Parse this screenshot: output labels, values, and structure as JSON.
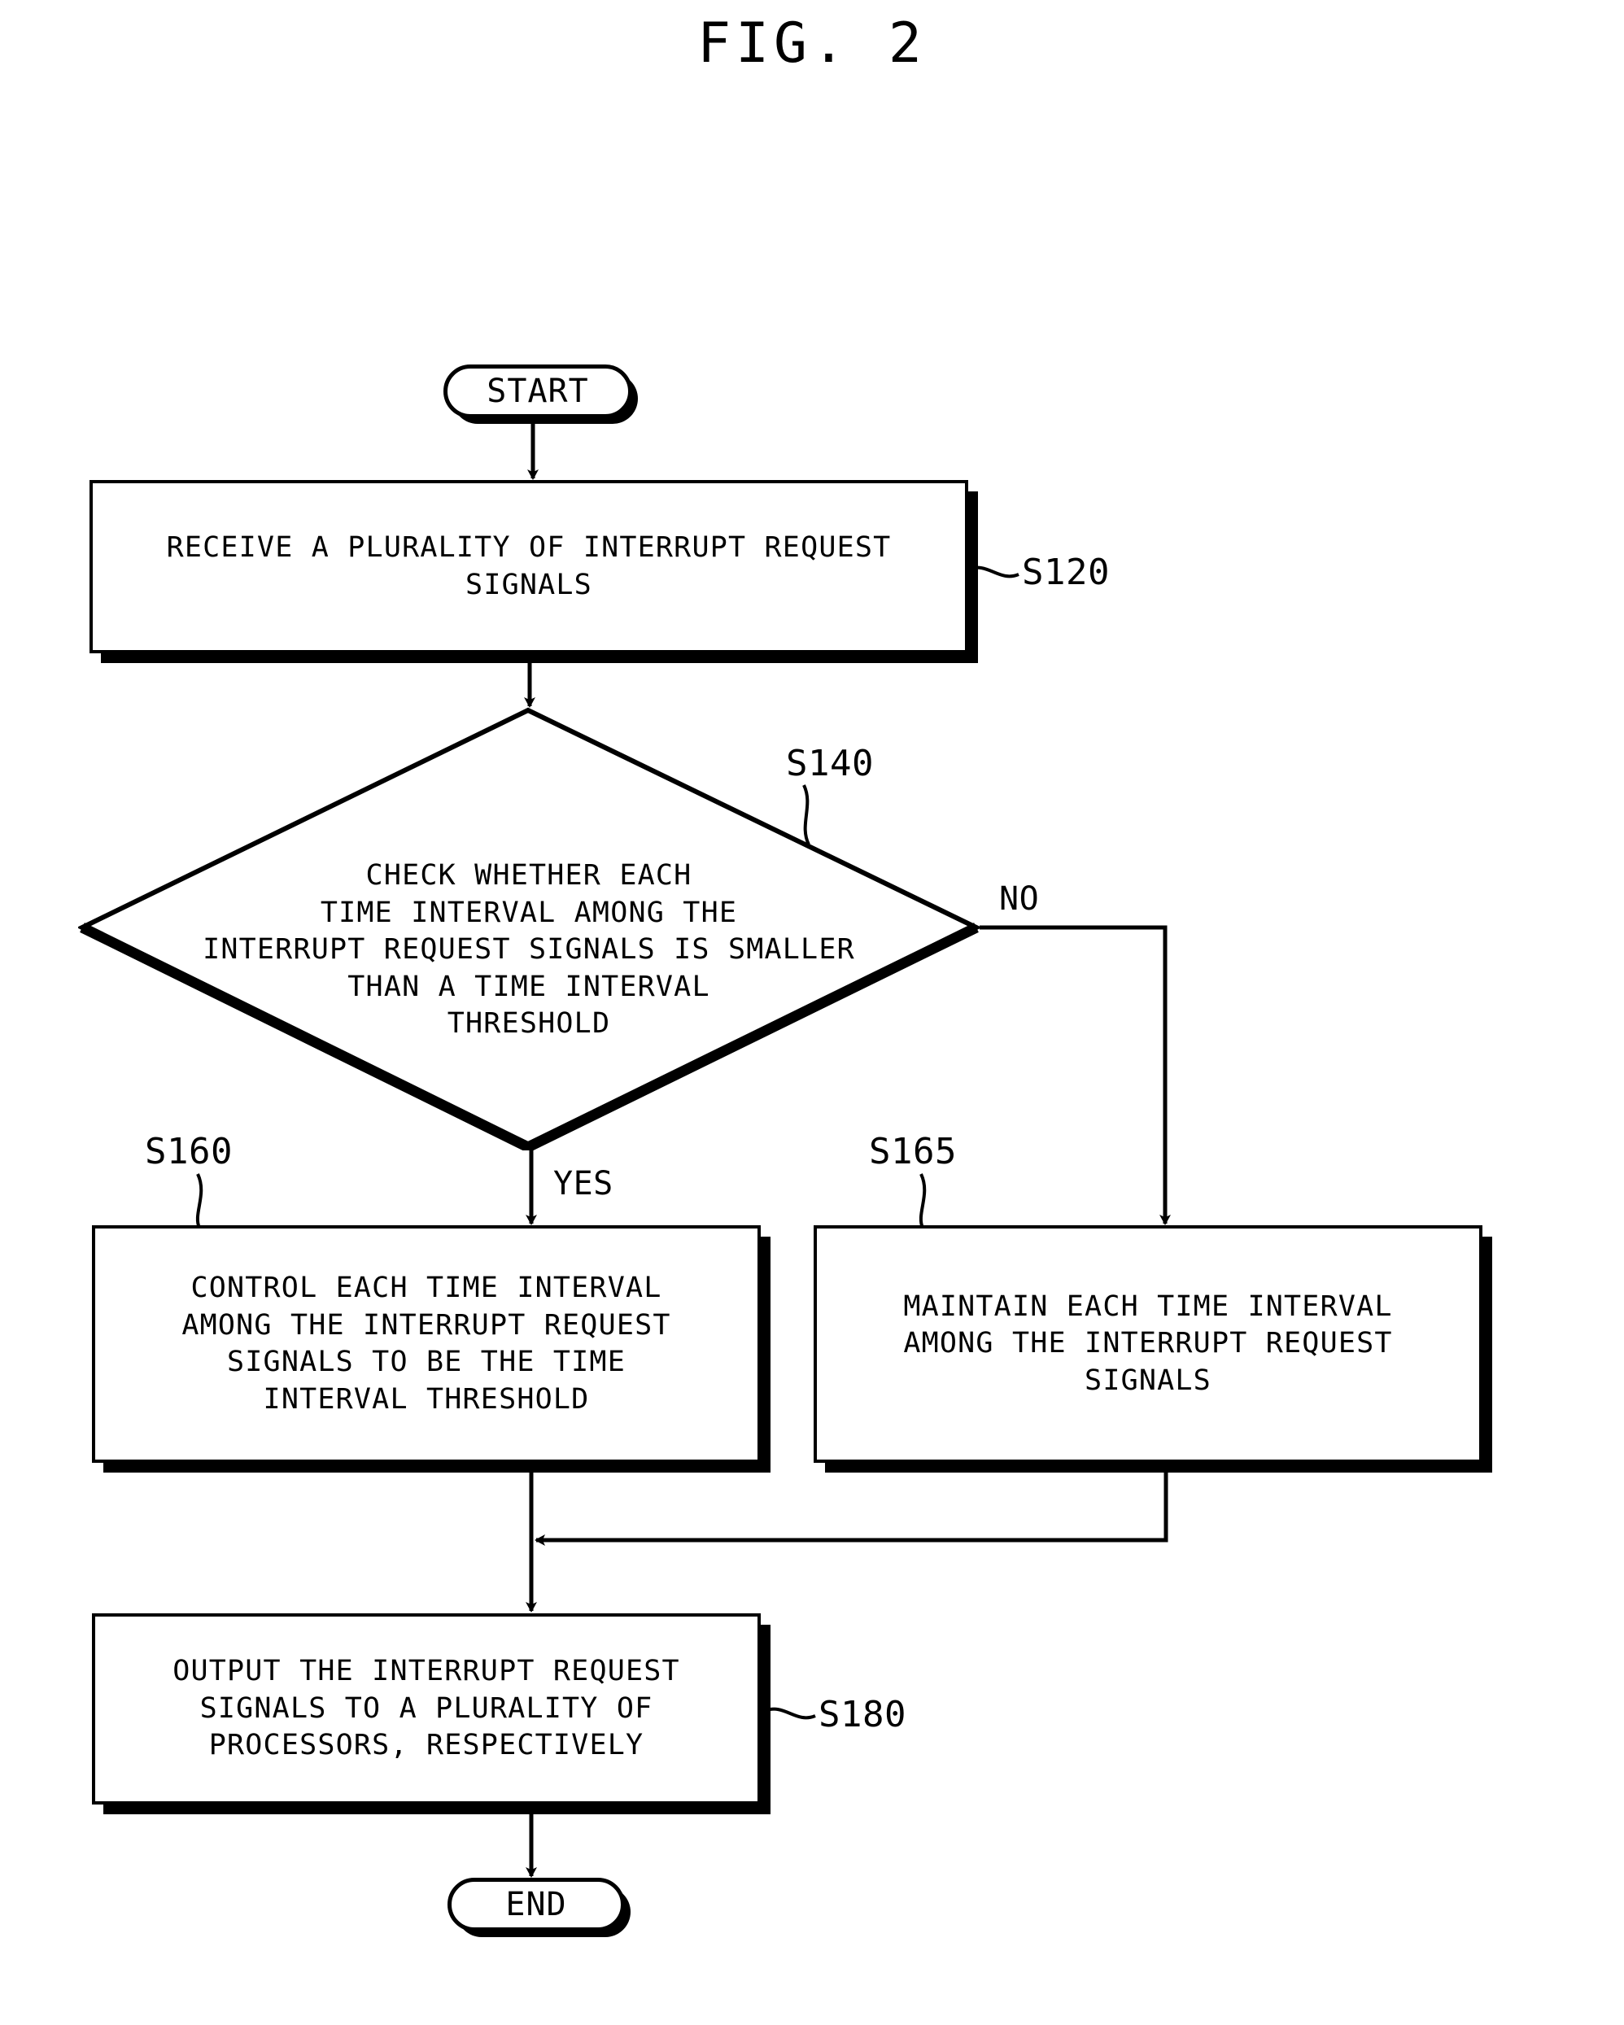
{
  "figure": {
    "title": "FIG. 2"
  },
  "flowchart": {
    "type": "flowchart",
    "nodes": [
      {
        "id": "start",
        "shape": "terminator",
        "label": "START"
      },
      {
        "id": "s120",
        "shape": "process",
        "label": "RECEIVE A PLURALITY OF INTERRUPT REQUEST\nSIGNALS",
        "ref": "S120"
      },
      {
        "id": "s140",
        "shape": "decision",
        "label": "CHECK WHETHER EACH\nTIME INTERVAL AMONG THE\nINTERRUPT REQUEST SIGNALS IS SMALLER\nTHAN A TIME INTERVAL\nTHRESHOLD",
        "ref": "S140"
      },
      {
        "id": "s160",
        "shape": "process",
        "label": "CONTROL EACH TIME INTERVAL\nAMONG THE INTERRUPT REQUEST\nSIGNALS TO BE THE TIME\nINTERVAL THRESHOLD",
        "ref": "S160"
      },
      {
        "id": "s165",
        "shape": "process",
        "label": "MAINTAIN EACH TIME INTERVAL\nAMONG THE INTERRUPT REQUEST\nSIGNALS",
        "ref": "S165"
      },
      {
        "id": "s180",
        "shape": "process",
        "label": "OUTPUT THE INTERRUPT REQUEST\nSIGNALS TO A PLURALITY OF\nPROCESSORS, RESPECTIVELY",
        "ref": "S180"
      },
      {
        "id": "end",
        "shape": "terminator",
        "label": "END"
      }
    ],
    "edges": [
      {
        "from": "start",
        "to": "s120",
        "label": ""
      },
      {
        "from": "s120",
        "to": "s140",
        "label": ""
      },
      {
        "from": "s140",
        "to": "s160",
        "label": "YES"
      },
      {
        "from": "s140",
        "to": "s165",
        "label": "NO"
      },
      {
        "from": "s160",
        "to": "s180",
        "label": ""
      },
      {
        "from": "s165",
        "to": "s180",
        "label": ""
      },
      {
        "from": "s180",
        "to": "end",
        "label": ""
      }
    ],
    "branch_labels": {
      "yes": "YES",
      "no": "NO"
    },
    "refs": {
      "s120": "S120",
      "s140": "S140",
      "s160": "S160",
      "s165": "S165",
      "s180": "S180"
    },
    "colors": {
      "stroke": "#000000",
      "fill": "#ffffff",
      "shadow": "#000000"
    }
  }
}
